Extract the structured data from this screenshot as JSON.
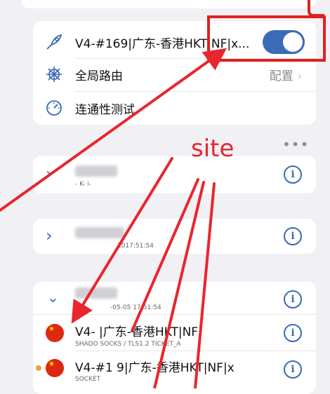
{
  "vpn": {
    "server_name": "V4-#169|广东-香港HKT|NF|x...",
    "global_route_label": "全局路由",
    "global_route_value": "配置",
    "connectivity_test_label": "连通性测试"
  },
  "groups": [
    {
      "subtitle": "- K- i-"
    },
    {
      "subtitle": "2017:51:54"
    },
    {
      "subtitle": "-05-05 17:51:54"
    }
  ],
  "servers": [
    {
      "name": "V4-      |广东-香港HKT|NF|",
      "protocol": "SHADO   SOCKS  / TLS1.2 TICKET_A"
    },
    {
      "name": "V4-#1  9|广东-香港HKT|NF|x",
      "protocol": "   SOCKET"
    }
  ],
  "annotation": {
    "label": "site",
    "color": "#e8262e"
  },
  "colors": {
    "accent": "#3a6bb5",
    "annotation_red": "#e02020"
  }
}
